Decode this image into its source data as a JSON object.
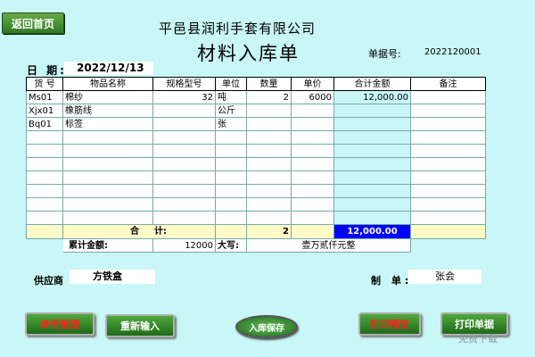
{
  "back_button": "返回首页",
  "company_name": "平邑县润利手套有限公司",
  "doc_title": "材料入库单",
  "doc_no": {
    "label": "单据号:",
    "value": "2022120001"
  },
  "date": {
    "label": "日 期:",
    "value": "2022/12/13"
  },
  "table": {
    "headers": [
      "货 号",
      "物品名称",
      "规格型号",
      "单位",
      "数量",
      "单价",
      "合计金额",
      "备注"
    ],
    "rows": [
      [
        "Ms01",
        "棉纱",
        "32",
        "吨",
        "2",
        "6000",
        "12,000.00",
        ""
      ],
      [
        "Xjx01",
        "橡筋线",
        "",
        "公斤",
        "",
        "",
        "",
        ""
      ],
      [
        "Bq01",
        "标签",
        "",
        "张",
        "",
        "",
        "",
        ""
      ],
      [
        "",
        "",
        "",
        "",
        "",
        "",
        "",
        ""
      ],
      [
        "",
        "",
        "",
        "",
        "",
        "",
        "",
        ""
      ],
      [
        "",
        "",
        "",
        "",
        "",
        "",
        "",
        ""
      ],
      [
        "",
        "",
        "",
        "",
        "",
        "",
        "",
        ""
      ],
      [
        "",
        "",
        "",
        "",
        "",
        "",
        "",
        ""
      ],
      [
        "",
        "",
        "",
        "",
        "",
        "",
        "",
        ""
      ],
      [
        "",
        "",
        "",
        "",
        "",
        "",
        "",
        ""
      ]
    ],
    "sum_row": {
      "label_he": "合",
      "label_ji": "计:",
      "quantity": "2",
      "amount": "12,000.00"
    },
    "total_row": {
      "label": "累计金额:",
      "amount": "12000",
      "uppercase_label": "大写:",
      "uppercase_value": "壹万贰仟元整"
    }
  },
  "supplier": {
    "label": "供应商",
    "value": "方铁盒"
  },
  "maker": {
    "label": "制 单:",
    "value": "张会"
  },
  "buttons": {
    "doc_manage": "单号管理",
    "re_input": "重新输入",
    "save": "入库保存",
    "print_preview": "打印预览",
    "print_doc": "打印单据"
  },
  "watermark": "免费下载"
}
